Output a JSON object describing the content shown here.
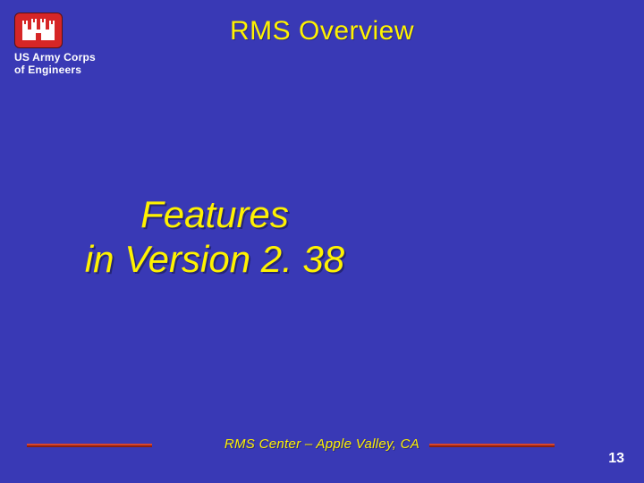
{
  "logo": {
    "org_line1": "US Army Corps",
    "org_line2": "of Engineers"
  },
  "title": "RMS Overview",
  "heading_line1": "Features",
  "heading_line2": "in Version 2. 38",
  "footer_text": "RMS Center – Apple Valley, CA",
  "page_number": "13",
  "colors": {
    "background": "#3939b5",
    "accent_yellow": "#fff200",
    "logo_red": "#d62626",
    "rule_red": "#d9452b"
  }
}
